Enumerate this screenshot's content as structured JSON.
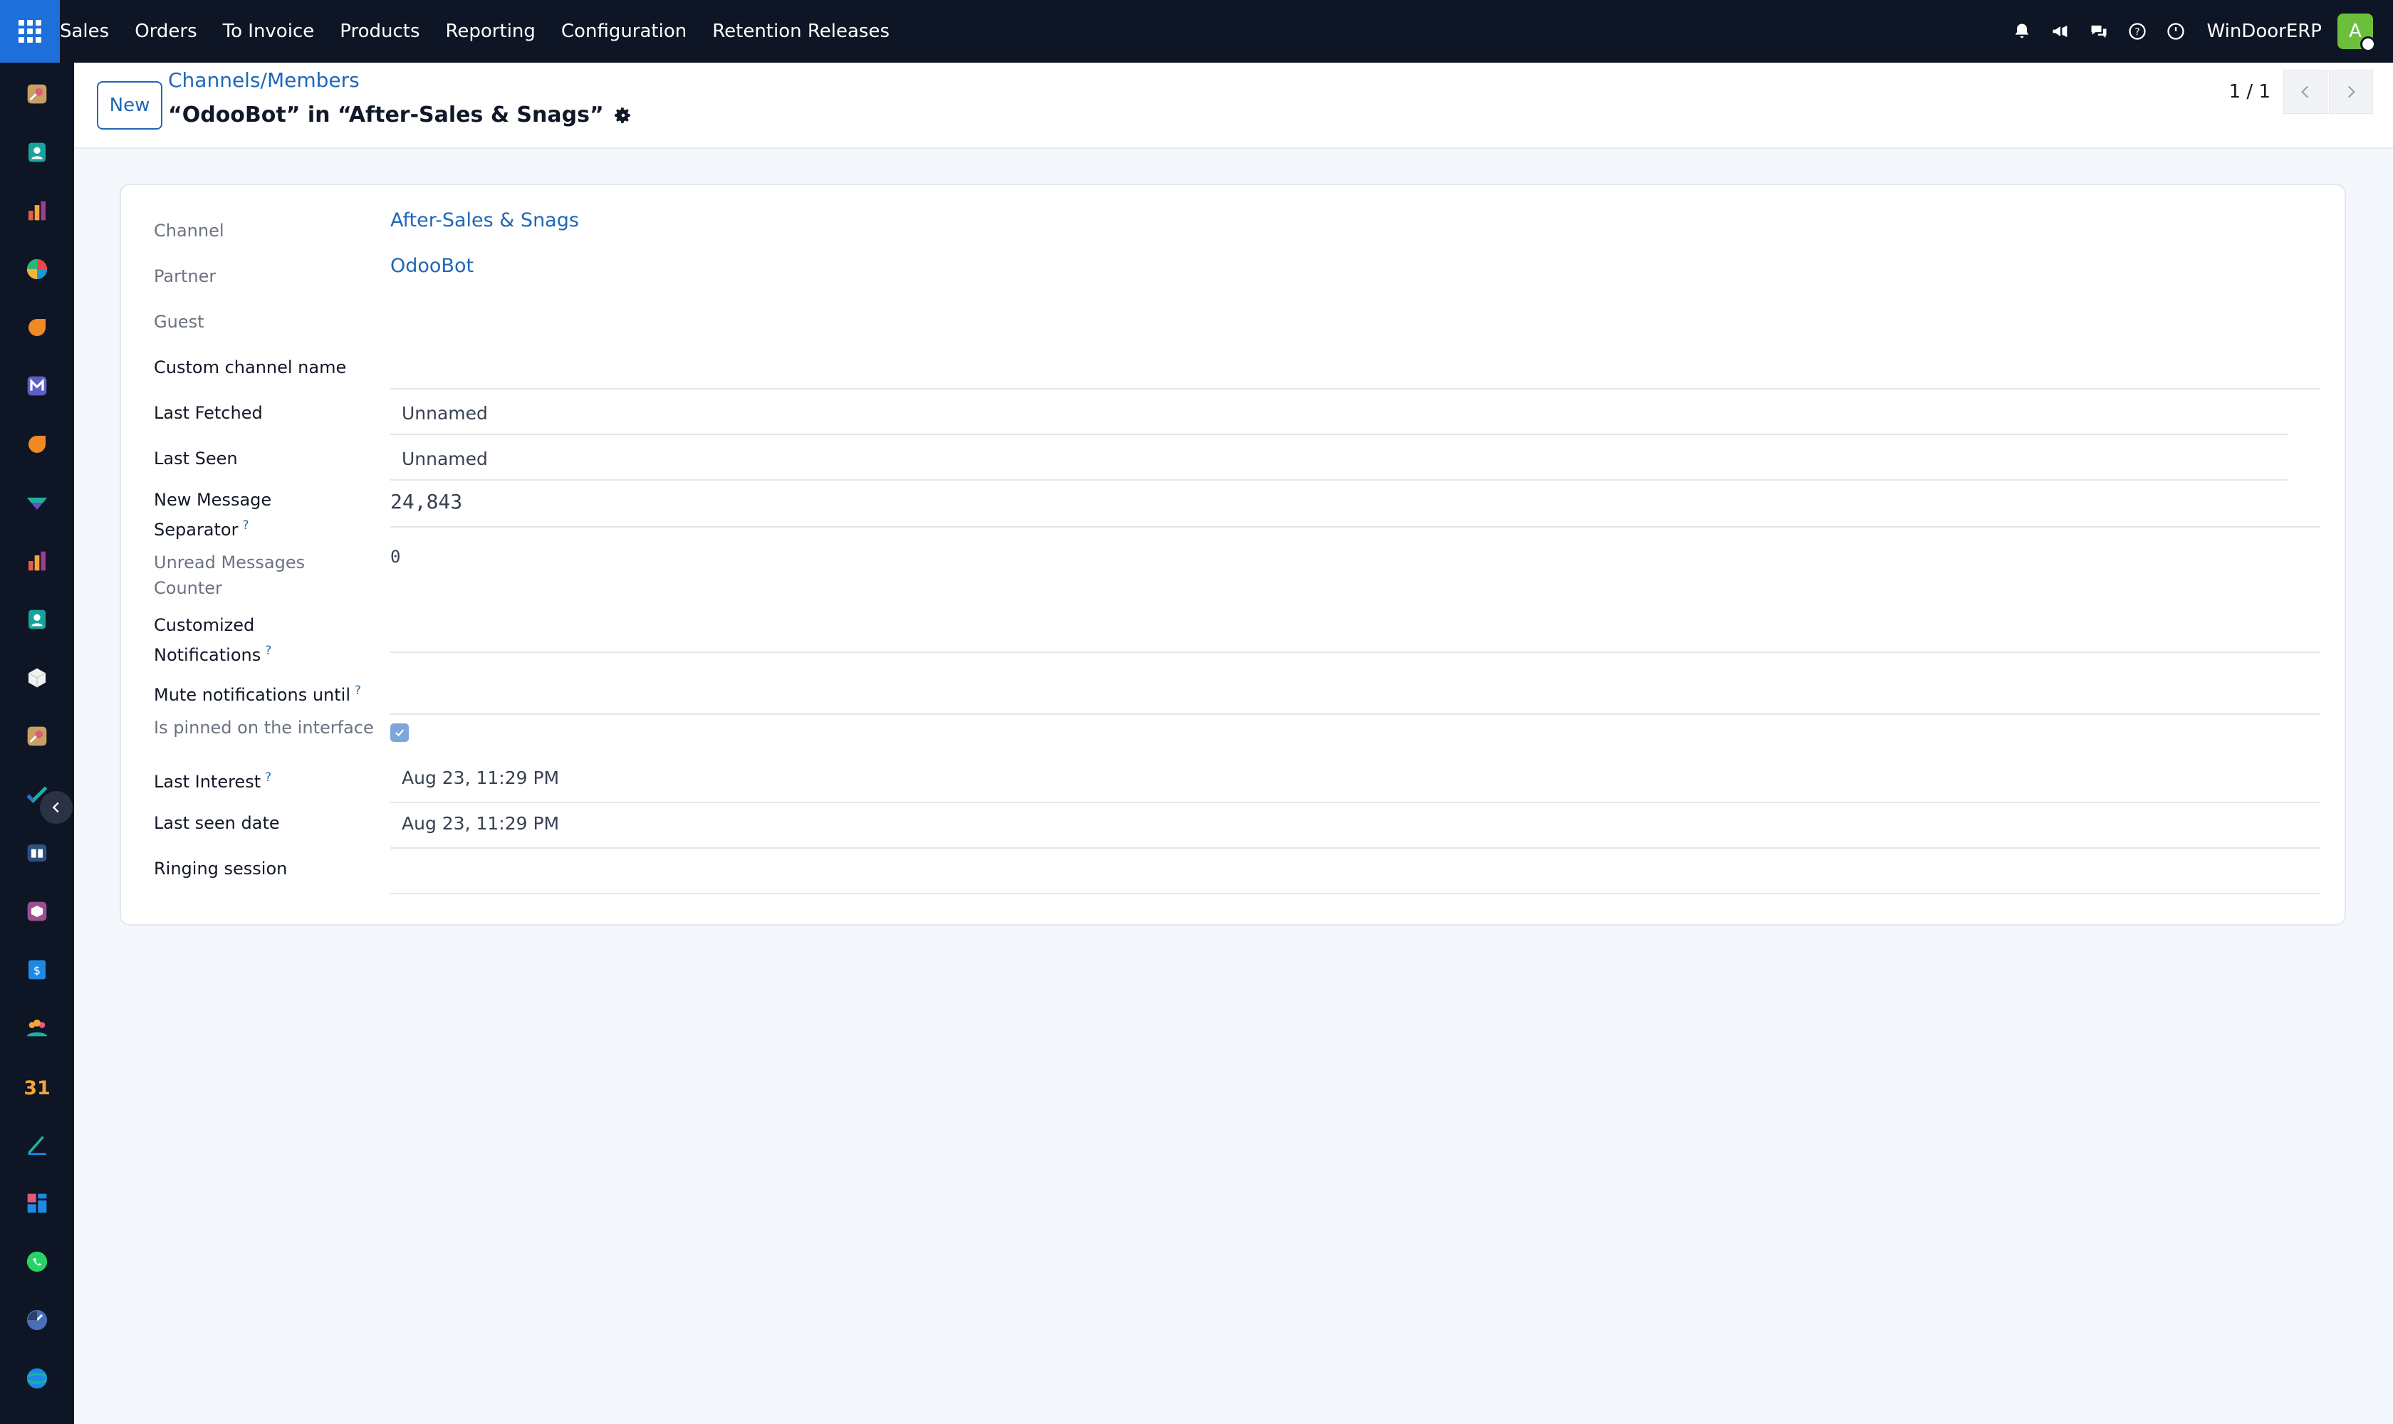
{
  "navbar": {
    "apps_icon": "apps-grid-icon",
    "menu": [
      "Sales",
      "Orders",
      "To Invoice",
      "Products",
      "Reporting",
      "Configuration",
      "Retention Releases"
    ],
    "right_icons": [
      "bell-icon",
      "megaphone-icon",
      "chat-icon",
      "help-icon",
      "clock-icon"
    ],
    "company": "WinDoorERP",
    "avatar_letter": "A",
    "avatar_color": "#6cbf3b"
  },
  "sidebar": {
    "icons": [
      "construction-app-icon",
      "contacts-app-icon",
      "reporting-app-icon",
      "dashboard-app-icon",
      "discuss-app-icon",
      "email-marketing-app-icon",
      "livechat-app-icon",
      "inventory-app-icon",
      "reporting-app-icon",
      "employees-app-icon",
      "product-box-app-icon",
      "construction-app-icon",
      "project-app-icon",
      "knowledge-app-icon",
      "inventory-box-app-icon",
      "invoicing-app-icon",
      "team-app-icon",
      "calendar-app-icon",
      "sign-app-icon",
      "dashboard-app-icon",
      "whatsapp-app-icon",
      "timesheet-app-icon",
      "surveys-app-icon"
    ]
  },
  "control": {
    "new_label": "New",
    "breadcrumb": "Channels/Members",
    "title": "“OdooBot” in “After-Sales & Snags”",
    "pager": "1 / 1"
  },
  "form": {
    "channel": {
      "label": "Channel",
      "value": "After-Sales & Snags"
    },
    "partner": {
      "label": "Partner",
      "value": "OdooBot"
    },
    "guest": {
      "label": "Guest",
      "value": ""
    },
    "custom_channel_name": {
      "label": "Custom channel name",
      "value": ""
    },
    "last_fetched": {
      "label": "Last Fetched",
      "value": "Unnamed"
    },
    "last_seen": {
      "label": "Last Seen",
      "value": "Unnamed"
    },
    "new_message_separator": {
      "label_line1": "New Message",
      "label_line2": "Separator",
      "help": "?",
      "value": "24,843"
    },
    "unread_counter": {
      "label_line1": "Unread Messages",
      "label_line2": "Counter",
      "value": "0"
    },
    "customized_notifications": {
      "label_line1": "Customized",
      "label_line2": "Notifications",
      "help": "?",
      "value": ""
    },
    "mute_until": {
      "label": "Mute notifications until",
      "help": "?",
      "value": ""
    },
    "is_pinned": {
      "label": "Is pinned on the interface",
      "checked": true
    },
    "last_interest": {
      "label": "Last Interest",
      "help": "?",
      "value": "Aug 23, 11:29 PM"
    },
    "last_seen_date": {
      "label": "Last seen date",
      "value": "Aug 23, 11:29 PM"
    },
    "ringing_session": {
      "label": "Ringing session",
      "value": ""
    }
  },
  "colors": {
    "navbar_bg": "#0e1525",
    "apps_button": "#1e6fd9",
    "link": "#1f67b8",
    "page_bg": "#f4f7fb"
  }
}
